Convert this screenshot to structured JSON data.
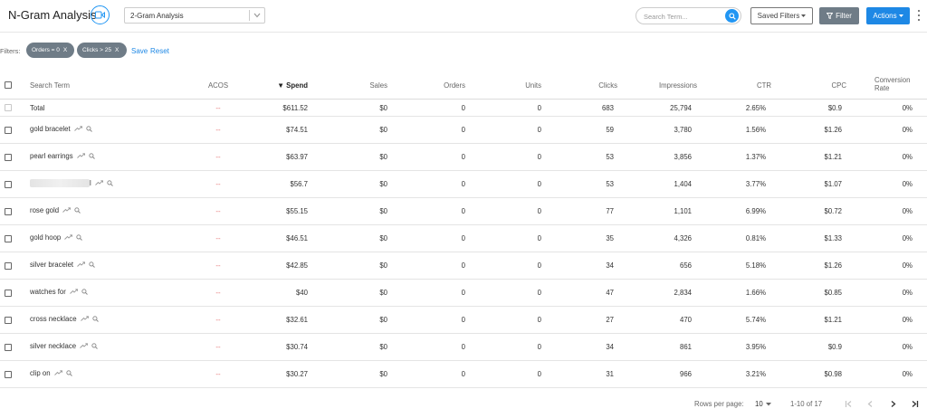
{
  "header": {
    "title": "N-Gram Analysis",
    "gram_select": "2-Gram Analysis",
    "search_placeholder": "Search Term...",
    "saved_filters_label": "Saved Filters",
    "filter_label": "Filter",
    "actions_label": "Actions"
  },
  "filters": {
    "label": "Filters:",
    "chips": [
      {
        "label": "Orders = 0",
        "remove": "X"
      },
      {
        "label": "Clicks > 25",
        "remove": "X"
      }
    ],
    "save_label": "Save",
    "reset_label": "Reset"
  },
  "table": {
    "columns": {
      "search_term": "Search Term",
      "acos": "ACOS",
      "spend": "Spend",
      "sales": "Sales",
      "orders": "Orders",
      "units": "Units",
      "clicks": "Clicks",
      "impressions": "Impressions",
      "ctr": "CTR",
      "cpc": "CPC",
      "conversion_rate_1": "Conversion",
      "conversion_rate_2": "Rate"
    },
    "sort_indicator": "▼",
    "total": {
      "term": "Total",
      "acos": "--",
      "spend": "$611.52",
      "sales": "$0",
      "orders": "0",
      "units": "0",
      "clicks": "683",
      "impressions": "25,794",
      "ctr": "2.65%",
      "cpc": "$0.9",
      "conversion_rate": "0%"
    },
    "rows": [
      {
        "term": "gold bracelet",
        "acos": "--",
        "spend": "$74.51",
        "sales": "$0",
        "orders": "0",
        "units": "0",
        "clicks": "59",
        "impressions": "3,780",
        "ctr": "1.56%",
        "cpc": "$1.26",
        "conversion_rate": "0%"
      },
      {
        "term": "pearl earrings",
        "acos": "--",
        "spend": "$63.97",
        "sales": "$0",
        "orders": "0",
        "units": "0",
        "clicks": "53",
        "impressions": "3,856",
        "ctr": "1.37%",
        "cpc": "$1.21",
        "conversion_rate": "0%"
      },
      {
        "term": "l",
        "blurred": true,
        "acos": "--",
        "spend": "$56.7",
        "sales": "$0",
        "orders": "0",
        "units": "0",
        "clicks": "53",
        "impressions": "1,404",
        "ctr": "3.77%",
        "cpc": "$1.07",
        "conversion_rate": "0%"
      },
      {
        "term": "rose gold",
        "acos": "--",
        "spend": "$55.15",
        "sales": "$0",
        "orders": "0",
        "units": "0",
        "clicks": "77",
        "impressions": "1,101",
        "ctr": "6.99%",
        "cpc": "$0.72",
        "conversion_rate": "0%"
      },
      {
        "term": "gold hoop",
        "acos": "--",
        "spend": "$46.51",
        "sales": "$0",
        "orders": "0",
        "units": "0",
        "clicks": "35",
        "impressions": "4,326",
        "ctr": "0.81%",
        "cpc": "$1.33",
        "conversion_rate": "0%"
      },
      {
        "term": "silver bracelet",
        "acos": "--",
        "spend": "$42.85",
        "sales": "$0",
        "orders": "0",
        "units": "0",
        "clicks": "34",
        "impressions": "656",
        "ctr": "5.18%",
        "cpc": "$1.26",
        "conversion_rate": "0%"
      },
      {
        "term": "watches for",
        "acos": "--",
        "spend": "$40",
        "sales": "$0",
        "orders": "0",
        "units": "0",
        "clicks": "47",
        "impressions": "2,834",
        "ctr": "1.66%",
        "cpc": "$0.85",
        "conversion_rate": "0%"
      },
      {
        "term": "cross necklace",
        "acos": "--",
        "spend": "$32.61",
        "sales": "$0",
        "orders": "0",
        "units": "0",
        "clicks": "27",
        "impressions": "470",
        "ctr": "5.74%",
        "cpc": "$1.21",
        "conversion_rate": "0%"
      },
      {
        "term": "silver necklace",
        "acos": "--",
        "spend": "$30.74",
        "sales": "$0",
        "orders": "0",
        "units": "0",
        "clicks": "34",
        "impressions": "861",
        "ctr": "3.95%",
        "cpc": "$0.9",
        "conversion_rate": "0%"
      },
      {
        "term": "clip on",
        "acos": "--",
        "spend": "$30.27",
        "sales": "$0",
        "orders": "0",
        "units": "0",
        "clicks": "31",
        "impressions": "966",
        "ctr": "3.21%",
        "cpc": "$0.98",
        "conversion_rate": "0%"
      }
    ]
  },
  "pagination": {
    "rows_per_page_label": "Rows per page:",
    "rows_per_page_value": "10",
    "range_label": "1-10 of 17"
  },
  "colors": {
    "accent": "#1e88e5",
    "chip": "#6f7c87",
    "acos_dash": "#e57373"
  },
  "icons": [
    "video-icon",
    "chevron-down-icon",
    "search-icon",
    "filter-icon",
    "kebab-icon",
    "trend-icon",
    "magnifier-icon",
    "first-page-icon",
    "prev-page-icon",
    "next-page-icon",
    "last-page-icon"
  ]
}
